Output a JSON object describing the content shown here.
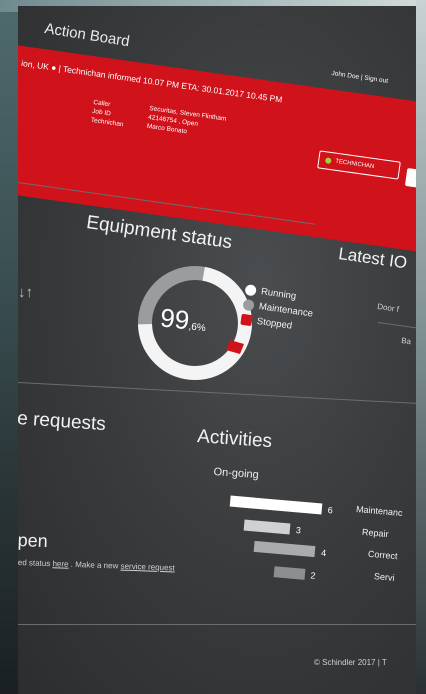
{
  "app": {
    "title": "Action Board"
  },
  "banner": {
    "location": "ion, UK",
    "status_line": "| Technichan informed 10.07 PM  ETA: 30.01.2017  10.45 PM",
    "user": "John Doe  |  Sign out",
    "labels": [
      "Caller",
      "Job ID",
      "Technichan"
    ],
    "values": [
      "Securitas, Steven Flintham",
      "42146754 , Open",
      "Marco Bonato"
    ],
    "tech_button": "TECHNICHAN"
  },
  "equipment": {
    "title": "Equipment status",
    "percent_main": "99",
    "percent_decimal": ",6%",
    "running_fraction": 0.996,
    "legend": [
      "Running",
      "Maintenance",
      "Stopped"
    ]
  },
  "latest": {
    "title": "Latest IO",
    "col1": "Door f",
    "col2": "Ba"
  },
  "requests": {
    "title": "e requests",
    "open_label": "pen",
    "status_text": "ed status",
    "here_link": "here",
    "new_text": ". Make a new",
    "service_link": "service request"
  },
  "activities": {
    "title": "Activities",
    "subtitle": "On-going",
    "rows": [
      {
        "label": "Maintenanc",
        "value": "6"
      },
      {
        "label": "Repair",
        "value": "3"
      },
      {
        "label": "Correct",
        "value": "4"
      },
      {
        "label": "Servi",
        "value": "2"
      }
    ]
  },
  "footer": {
    "text": "© Schindler 2017  |  T"
  },
  "colors": {
    "banner_red": "#d0121b",
    "accent_red": "#d0121b"
  }
}
